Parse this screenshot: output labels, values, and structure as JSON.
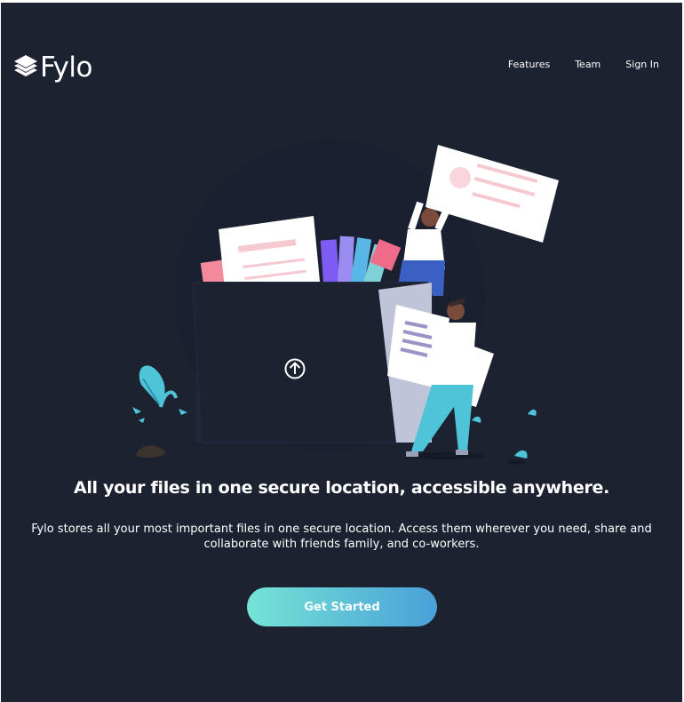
{
  "brand": {
    "name": "Fylo",
    "logo_icon": "stacked-layers-icon"
  },
  "nav": {
    "links": [
      {
        "label": "Features"
      },
      {
        "label": "Team"
      },
      {
        "label": "Sign In"
      }
    ]
  },
  "hero": {
    "illustration": "folder-upload-illustration",
    "upload_icon": "upload-arrow-icon",
    "headline": "All your files in one secure location, accessible anywhere.",
    "description": "Fylo stores all your most important files in one secure location. Access them wherever you need, share and collaborate with friends family, and co-workers.",
    "cta_label": "Get Started"
  },
  "colors": {
    "background": "#1c2230",
    "text": "#ffffff",
    "cta_gradient_start": "#75e4d6",
    "cta_gradient_end": "#4aa0d8",
    "accent_cyan": "#4fc3d8",
    "accent_pink": "#f28a9c"
  }
}
